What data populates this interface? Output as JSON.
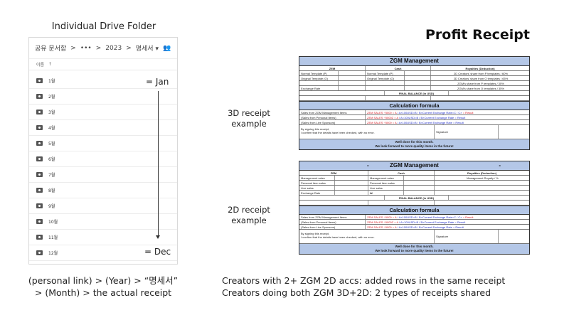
{
  "left": {
    "title": "Individual Drive Folder",
    "path": [
      "공유 문서함",
      ">",
      "•••",
      ">",
      "2023",
      ">",
      "명세서 ▾",
      "👥"
    ],
    "header": {
      "name": "이름",
      "sort_arrow": "↑"
    },
    "months": [
      "1월",
      "2월",
      "3월",
      "4월",
      "5월",
      "6월",
      "7월",
      "8월",
      "9월",
      "10월",
      "11월",
      "12월"
    ],
    "jan_label": "= Jan",
    "dec_label": "= Dec",
    "caption_line1": "(personal link) > (Year) > “명세서”",
    "caption_line2": "> (Month) > the actual receipt"
  },
  "middle": {
    "label_3d_line1": "3D receipt",
    "label_3d_line2": "example",
    "label_2d_line1": "2D receipt",
    "label_2d_line2": "example"
  },
  "right": {
    "title": "Profit Receipt",
    "caption_line1": "Creators with 2+ ZGM 2D accs: added rows in the same receipt",
    "caption_line2": "Creators doing both ZGM 3D+2D: 2 types of receipts shared"
  },
  "receipt3d": {
    "title": "ZGM Management",
    "col_zem": "ZEM",
    "col_cash": "Cash",
    "col_roy": "Royalties (Deduction)",
    "rows": [
      [
        "Normal Template (P)",
        "Normal Template (P)",
        "2D Creators' share from P templates / 60%"
      ],
      [
        "Original Template (O)",
        "Original Template (O)",
        "2D Creators' share from O templates / 65%"
      ],
      [
        "",
        "",
        "ZGM's share from P templates / 30%"
      ],
      [
        "Exchange Rate",
        "",
        "ZGM's share from O templates / 35%"
      ]
    ],
    "final_balance": "FINAL BALANCE (in USD)",
    "calc_title": "Calculation formula",
    "calc_rows": [
      [
        "Sales from ZGM Management Items",
        "ZEM SALES ÷5000 = A",
        " / A×100USD=B",
        " / B×Current Exchange Rate=C / C×",
        " = Result"
      ],
      [
        "(Sales from Personal Items)",
        "ZEM SALES ÷5000Z = A",
        " / A×100USD=B",
        " / B×Current Exchange Rate = Result",
        ""
      ],
      [
        "(Sales from Live Sponsors)",
        "ZEM SALES ÷5000 = A",
        " / A×100USD=B",
        " / B×Current Exchange Rate = Result",
        ""
      ]
    ],
    "sign_line1": "By signing this receipt,",
    "sign_line2": "I confirm that the details have been checked, with no error.",
    "signature": "Signature",
    "footer_line1": "Well done for this month.",
    "footer_line2": "We look forward to more quality items in the future!"
  },
  "receipt2d": {
    "title": "ZGM Management",
    "title_prefix": "-",
    "title_suffix": "-",
    "col_zem": "ZEM",
    "col_cash": "Cash",
    "col_roy": "Royalties (Deduction)",
    "rows": [
      [
        "Management sales",
        "Management sales",
        "Management Royalty /    %"
      ],
      [
        "Personal item sales",
        "Personal item sales",
        ""
      ],
      [
        "Live sales",
        "Live sales",
        ""
      ],
      [
        "Exchange Rate",
        "₩",
        ""
      ]
    ],
    "final_balance": "FINAL BALANCE (in USD)",
    "calc_title": "Calculation formula",
    "calc_rows": [
      [
        "Sales from ZGM Management Items",
        "ZEM SALES ÷5000 = A",
        " / A×100USD=B",
        " / B×Current Exchange Rate=C / C×",
        " = Result"
      ],
      [
        "(Sales from Personal Items)",
        "ZEM SALES ÷5000Z = A",
        " / A×100USD=B",
        " / B×Current Exchange Rate = Result",
        ""
      ],
      [
        "(Sales from Live Sponsors)",
        "ZEM SALES ÷5000 = A",
        " / A×100USD=B",
        " / B×Current Exchange Rate = Result",
        ""
      ]
    ],
    "sign_line1": "By signing this receipt,",
    "sign_line2": "I confirm that the details have been checked, with no error.",
    "signature": "Signature",
    "footer_line1": "Well done for this month.",
    "footer_line2": "We look forward to more quality items in the future!"
  },
  "colors": {
    "header_blue": "#b4c7e7",
    "formula_red": "#d8202a",
    "formula_blue": "#2430c8"
  }
}
